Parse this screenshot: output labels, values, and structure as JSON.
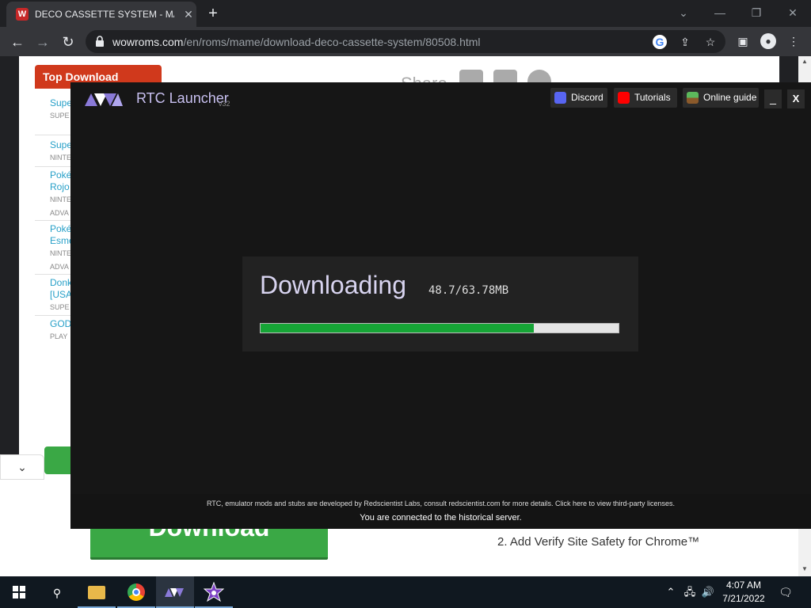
{
  "browser": {
    "tab_title": "DECO CASSETTE SYSTEM - MAME",
    "tab_favicon_letter": "W",
    "url_host": "wowroms.com",
    "url_path": "/en/roms/mame/download-deco-cassette-system/80508.html"
  },
  "website": {
    "top_download_title": "Top Download",
    "share_label": "Share",
    "game_list": [
      {
        "name": "Supe [USA",
        "system": "SUPE"
      },
      {
        "name": "Supe",
        "system": "NINTE"
      },
      {
        "name": "Poké Rojo",
        "system": "NINTE ADVA"
      },
      {
        "name": "Poké Esme",
        "system": "NINTE ADVA"
      },
      {
        "name": "Donk [USA",
        "system": "SUPE"
      },
      {
        "name": "GOD",
        "system": "PLAY"
      }
    ],
    "download_button_label": "Download",
    "verify_step_text": "2. Add Verify Site Safety for Chrome™"
  },
  "launcher": {
    "title": "RTC Launcher",
    "version": "v32",
    "links": [
      {
        "label": "Discord",
        "icon": "discord-icon",
        "color": "#5865f2"
      },
      {
        "label": "Tutorials",
        "icon": "youtube-icon",
        "color": "#ff0000"
      },
      {
        "label": "Online guide",
        "icon": "minecraft-grass-icon",
        "color": "#4caf50"
      }
    ],
    "minimize_label": "_",
    "close_label": "X",
    "download": {
      "status_label": "Downloading",
      "size_text": "48.7/63.78MB",
      "downloaded_mb": 48.7,
      "total_mb": 63.78
    },
    "footer_credits": "RTC, emulator mods and stubs are developed by Redscientist Labs, consult redscientist.com for more details. Click here to view third-party licenses.",
    "footer_status": "You are connected to the historical server."
  },
  "taskbar": {
    "time": "4:07 AM",
    "date": "7/21/2022"
  },
  "colors": {
    "accent_purple": "#c8c0f0",
    "progress_green": "#16a536",
    "top_download_red": "#d0391c",
    "download_green": "#3aa845"
  }
}
